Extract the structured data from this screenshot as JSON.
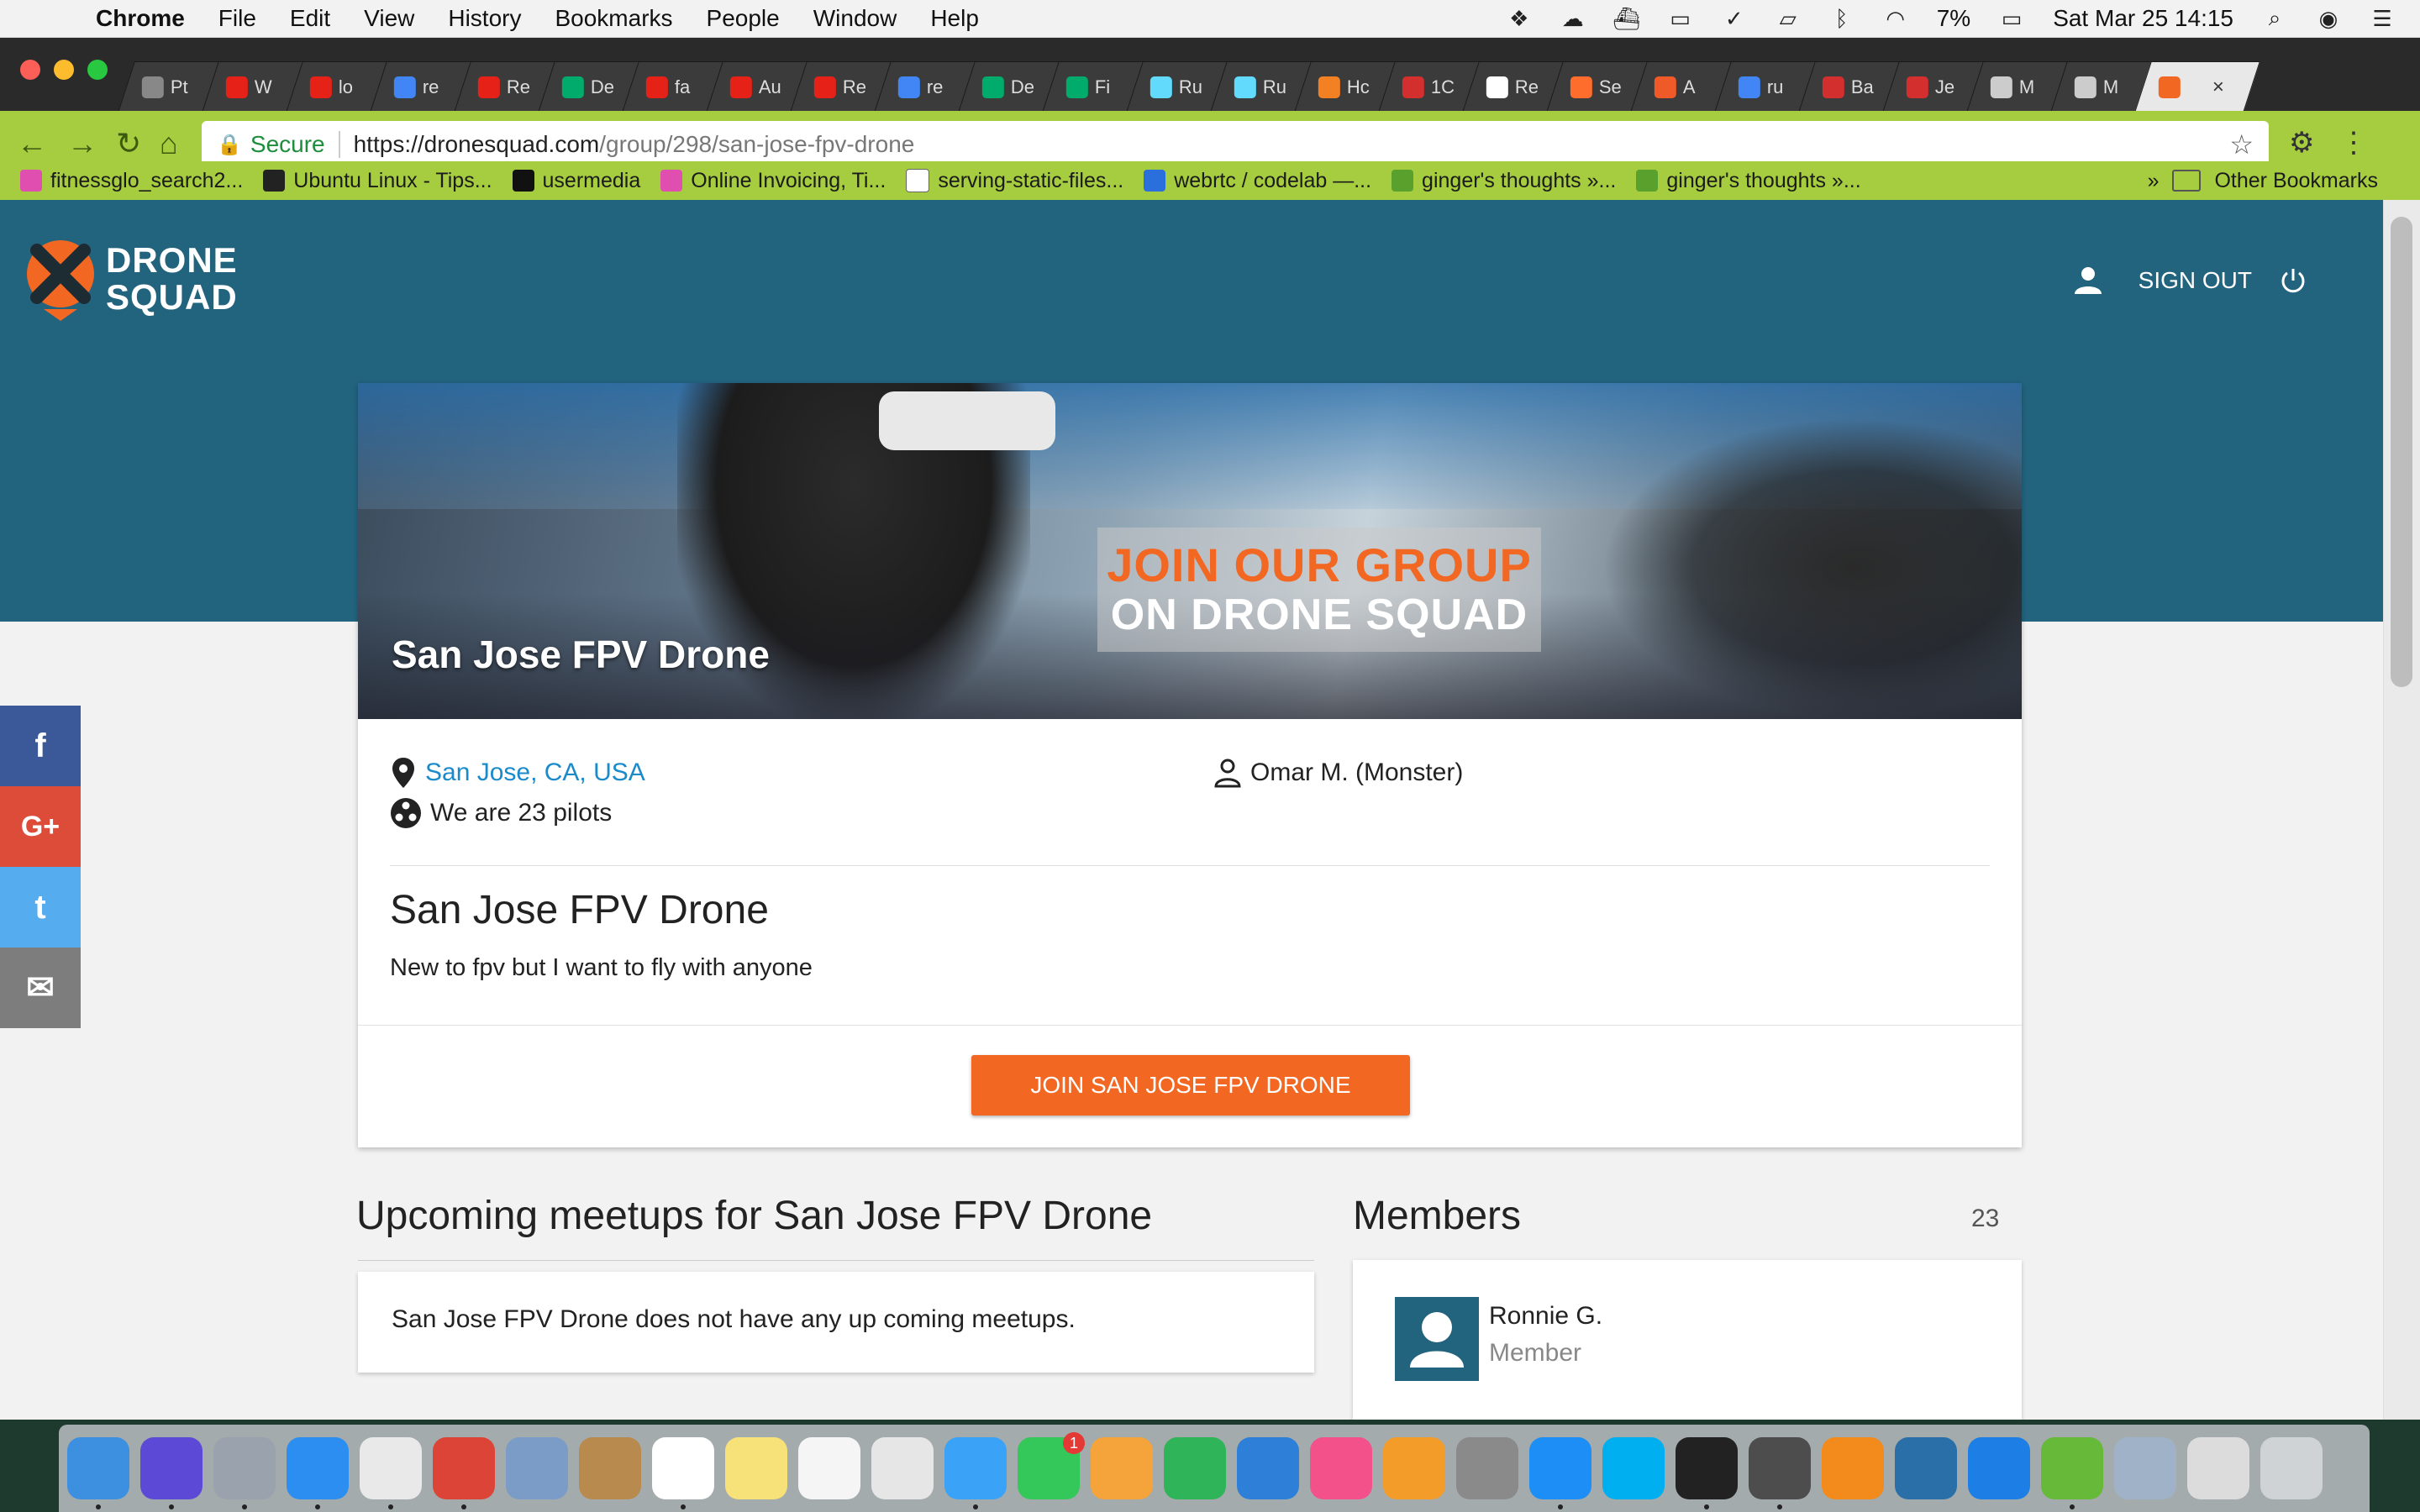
{
  "menubar": {
    "app": "Chrome",
    "menus": [
      "File",
      "Edit",
      "View",
      "History",
      "Bookmarks",
      "People",
      "Window",
      "Help"
    ],
    "battery": "7%",
    "clock": "Sat Mar 25  14:15"
  },
  "tabs": [
    {
      "label": "Pt",
      "color": "#888888"
    },
    {
      "label": "W",
      "color": "#e62117"
    },
    {
      "label": "lo",
      "color": "#e62117"
    },
    {
      "label": "re",
      "color": "#4285f4"
    },
    {
      "label": "Re",
      "color": "#e62117"
    },
    {
      "label": "De",
      "color": "#00ab6c"
    },
    {
      "label": "fa",
      "color": "#e62117"
    },
    {
      "label": "Au",
      "color": "#e62117"
    },
    {
      "label": "Re",
      "color": "#e62117"
    },
    {
      "label": "re",
      "color": "#4285f4"
    },
    {
      "label": "De",
      "color": "#00ab6c"
    },
    {
      "label": "Fi",
      "color": "#00ab6c"
    },
    {
      "label": "Ru",
      "color": "#61dafb"
    },
    {
      "label": "Ru",
      "color": "#61dafb"
    },
    {
      "label": "Hc",
      "color": "#f48024"
    },
    {
      "label": "1C",
      "color": "#d32f2f"
    },
    {
      "label": "Re",
      "color": "#ffffff"
    },
    {
      "label": "Se",
      "color": "#ff6d2d"
    },
    {
      "label": "A",
      "color": "#ef5a28"
    },
    {
      "label": "ru",
      "color": "#4285f4"
    },
    {
      "label": "Ba",
      "color": "#d32f2f"
    },
    {
      "label": "Je",
      "color": "#d32f2f"
    },
    {
      "label": "M",
      "color": "#cccccc"
    },
    {
      "label": "M",
      "color": "#cccccc"
    }
  ],
  "active_tab_close": "×",
  "toolbar": {
    "secure_label": "Secure",
    "url_host": "https://dronesquad.com",
    "url_path": "/group/298/san-jose-fpv-drone"
  },
  "bookmarks": [
    {
      "label": "fitnessglo_search2...",
      "color": "#e04fb0"
    },
    {
      "label": "Ubuntu Linux - Tips...",
      "color": "#222222"
    },
    {
      "label": "usermedia",
      "color": "#111111"
    },
    {
      "label": "Online Invoicing, Ti...",
      "color": "#e04fb0"
    },
    {
      "label": "serving-static-files...",
      "color": "#ffffff"
    },
    {
      "label": "webrtc / codelab —...",
      "color": "#2a6fdb"
    },
    {
      "label": "ginger's thoughts »...",
      "color": "#5aa02c"
    },
    {
      "label": "ginger's thoughts »...",
      "color": "#5aa02c"
    }
  ],
  "bookmarks_overflow": "»",
  "bookmarks_other": "Other Bookmarks",
  "site": {
    "logo_line1": "DRONE",
    "logo_line2": "SQUAD",
    "signout": "SIGN OUT",
    "brand_orange": "#f26722",
    "brand_teal": "#22637e"
  },
  "group": {
    "banner_line1": "JOIN OUR GROUP",
    "banner_line2": "ON DRONE SQUAD",
    "title": "San Jose FPV Drone",
    "location": "San Jose, CA, USA",
    "pilots": "We are 23 pilots",
    "owner": "Omar M. (Monster)",
    "name": "San Jose FPV Drone",
    "description": "New to fpv but I want to fly with anyone",
    "join_button": "JOIN SAN JOSE FPV DRONE"
  },
  "share": {
    "facebook": "f",
    "google": "G+",
    "twitter": "t",
    "email": "✉"
  },
  "meetups": {
    "title": "Upcoming meetups for San Jose FPV Drone",
    "empty": "San Jose FPV Drone does not have any up coming meetups."
  },
  "members": {
    "title": "Members",
    "count": "23",
    "list": [
      {
        "name": "Ronnie G.",
        "role": "Member"
      }
    ]
  },
  "dock": [
    {
      "name": "finder",
      "color": "#3d8fe0"
    },
    {
      "name": "siri",
      "color": "#5c4ad6"
    },
    {
      "name": "launchpad",
      "color": "#9aa2ad"
    },
    {
      "name": "safari",
      "color": "#2b8ef0"
    },
    {
      "name": "apps-grid",
      "color": "#e9e9e9"
    },
    {
      "name": "chrome",
      "color": "#db4437"
    },
    {
      "name": "preview-bird",
      "color": "#7a9cc6"
    },
    {
      "name": "contacts",
      "color": "#b98a4e"
    },
    {
      "name": "calendar",
      "color": "#ffffff"
    },
    {
      "name": "notes",
      "color": "#f7e27a"
    },
    {
      "name": "reminders",
      "color": "#f5f5f5"
    },
    {
      "name": "photos-preview",
      "color": "#e6e6e6"
    },
    {
      "name": "messages",
      "color": "#3ba3f7"
    },
    {
      "name": "facetime",
      "color": "#34c759"
    },
    {
      "name": "pages",
      "color": "#f4a43a"
    },
    {
      "name": "numbers",
      "color": "#2fb45a"
    },
    {
      "name": "keynote",
      "color": "#2d7fd8"
    },
    {
      "name": "itunes",
      "color": "#f25189"
    },
    {
      "name": "ibooks",
      "color": "#f39c2a"
    },
    {
      "name": "system-preferences",
      "color": "#8a8a8a"
    },
    {
      "name": "app-store",
      "color": "#1c8ef5"
    },
    {
      "name": "skype",
      "color": "#00aff0"
    },
    {
      "name": "terminal",
      "color": "#222222"
    },
    {
      "name": "sublime-text",
      "color": "#4d4d4d"
    },
    {
      "name": "vlc",
      "color": "#f28a1c"
    },
    {
      "name": "quicktime",
      "color": "#2b6fa8"
    },
    {
      "name": "xcode",
      "color": "#1d7fe5"
    },
    {
      "name": "atom",
      "color": "#67b93a"
    },
    {
      "name": "image-capture",
      "color": "#9fb2c7"
    },
    {
      "name": "file-stack",
      "color": "#dcdcdc"
    },
    {
      "name": "trash",
      "color": "#d0d3d6"
    }
  ],
  "dock_badge": "1"
}
